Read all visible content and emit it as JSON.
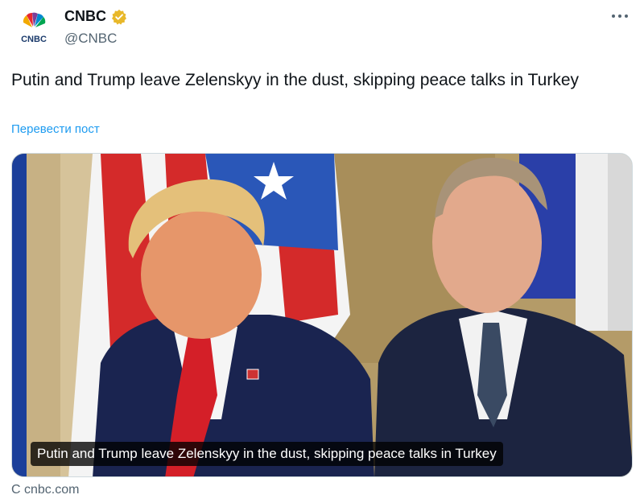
{
  "account": {
    "display_name": "CNBC",
    "handle": "@CNBC",
    "verified": true,
    "avatar_icon": "cnbc-peacock-logo",
    "verified_color": "#e8b82a"
  },
  "post": {
    "text": "Putin and Trump leave Zelenskyy in the dust, skipping peace talks in Turkey",
    "translate_label": "Перевести пост",
    "more_icon": "more-horizontal-icon"
  },
  "media": {
    "caption": "Putin and Trump leave Zelenskyy in the dust, skipping peace talks in Turkey"
  },
  "link_source": {
    "label": "С cnbc.com"
  },
  "colors": {
    "link": "#1d9bf0",
    "secondary_text": "#536471",
    "primary_text": "#0f1419"
  }
}
